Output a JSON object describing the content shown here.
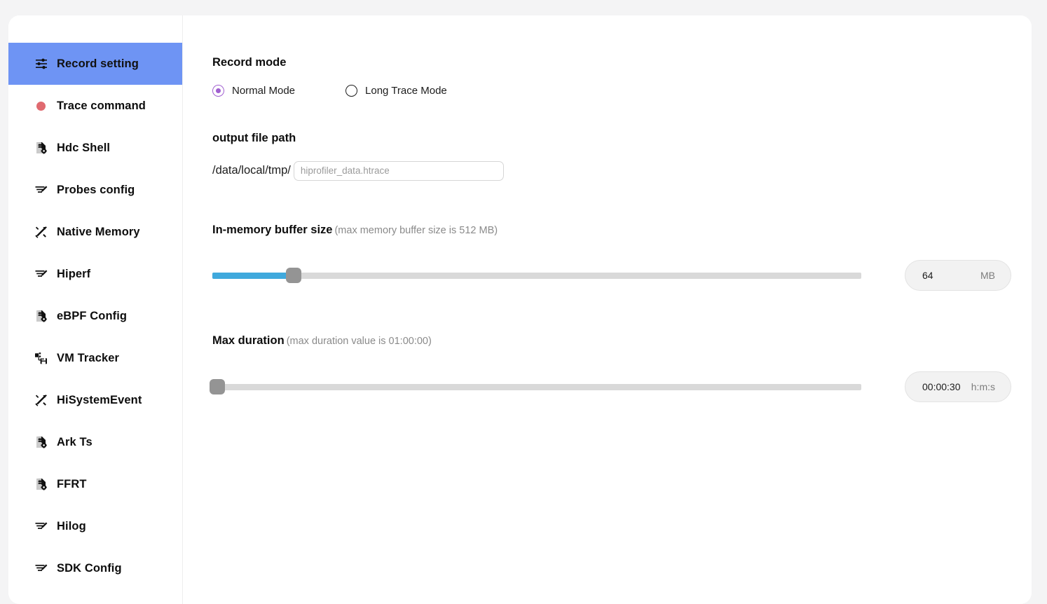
{
  "sidebar": {
    "items": [
      {
        "label": "Record setting",
        "icon": "sliders-icon",
        "selected": true
      },
      {
        "label": "Trace command",
        "icon": "record-dot-icon",
        "selected": false
      },
      {
        "label": "Hdc Shell",
        "icon": "file-gear-icon",
        "selected": false
      },
      {
        "label": "Probes config",
        "icon": "list-pencil-icon",
        "selected": false
      },
      {
        "label": "Native Memory",
        "icon": "tools-icon",
        "selected": false
      },
      {
        "label": "Hiperf",
        "icon": "list-pencil-icon",
        "selected": false
      },
      {
        "label": "eBPF Config",
        "icon": "file-gear-icon",
        "selected": false
      },
      {
        "label": "VM Tracker",
        "icon": "vm-disk-icon",
        "selected": false
      },
      {
        "label": "HiSystemEvent",
        "icon": "tools-icon",
        "selected": false
      },
      {
        "label": "Ark Ts",
        "icon": "file-gear-icon",
        "selected": false
      },
      {
        "label": "FFRT",
        "icon": "file-gear-icon",
        "selected": false
      },
      {
        "label": "Hilog",
        "icon": "list-pencil-icon",
        "selected": false
      },
      {
        "label": "SDK Config",
        "icon": "list-pencil-icon",
        "selected": false
      }
    ],
    "selected_bg": "#6e94f4"
  },
  "record_mode": {
    "title": "Record mode",
    "options": [
      {
        "label": "Normal Mode",
        "checked": true
      },
      {
        "label": "Long Trace Mode",
        "checked": false
      }
    ],
    "accent": "#a05fd0"
  },
  "output_path": {
    "title": "output file path",
    "prefix": "/data/local/tmp/",
    "value": "",
    "placeholder": "hiprofiler_data.htrace"
  },
  "buffer_size": {
    "title": "In-memory buffer size",
    "hint": "(max memory buffer size is 512 MB)",
    "value": "64",
    "unit": "MB",
    "percent": 12.5,
    "fill_color": "#3fa9dd",
    "thumb_color": "#949494",
    "track_color": "#d9d9d9"
  },
  "max_duration": {
    "title": "Max duration",
    "hint": "(max duration value is 01:00:00)",
    "value": "00:00:30",
    "unit": "h:m:s",
    "percent": 0.8,
    "fill_color": "#4fd0c4",
    "thumb_color": "#949494",
    "track_color": "#d9d9d9"
  }
}
